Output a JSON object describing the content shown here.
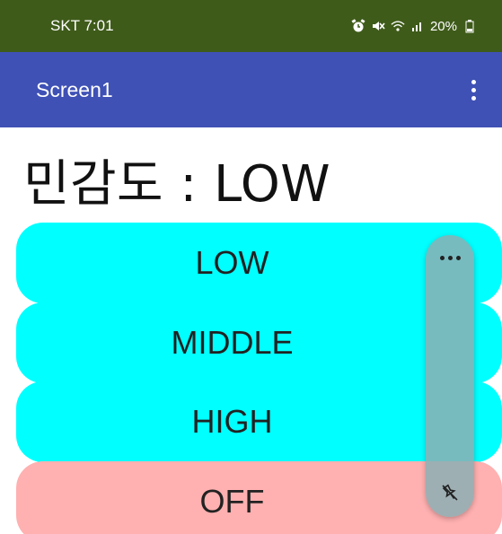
{
  "status_bar": {
    "carrier_time": "SKT 7:01",
    "battery": "20%",
    "icons": [
      "alarm-icon",
      "mute-icon",
      "wifi-icon",
      "signal-icon",
      "battery-icon"
    ]
  },
  "app_bar": {
    "title": "Screen1",
    "menu_icon": "overflow-menu-icon",
    "color": "#3f51b5"
  },
  "main": {
    "sensitivity_text": "민감도 : LOW",
    "buttons": [
      {
        "label": "LOW",
        "color": "#00ffff"
      },
      {
        "label": "MIDDLE",
        "color": "#00ffff"
      },
      {
        "label": "HIGH",
        "color": "#00ffff"
      },
      {
        "label": "OFF",
        "color": "#ffb0b0"
      }
    ]
  },
  "floating_panel": {
    "more_icon": "more-horizontal-icon",
    "unpin_icon": "unpin-icon"
  }
}
